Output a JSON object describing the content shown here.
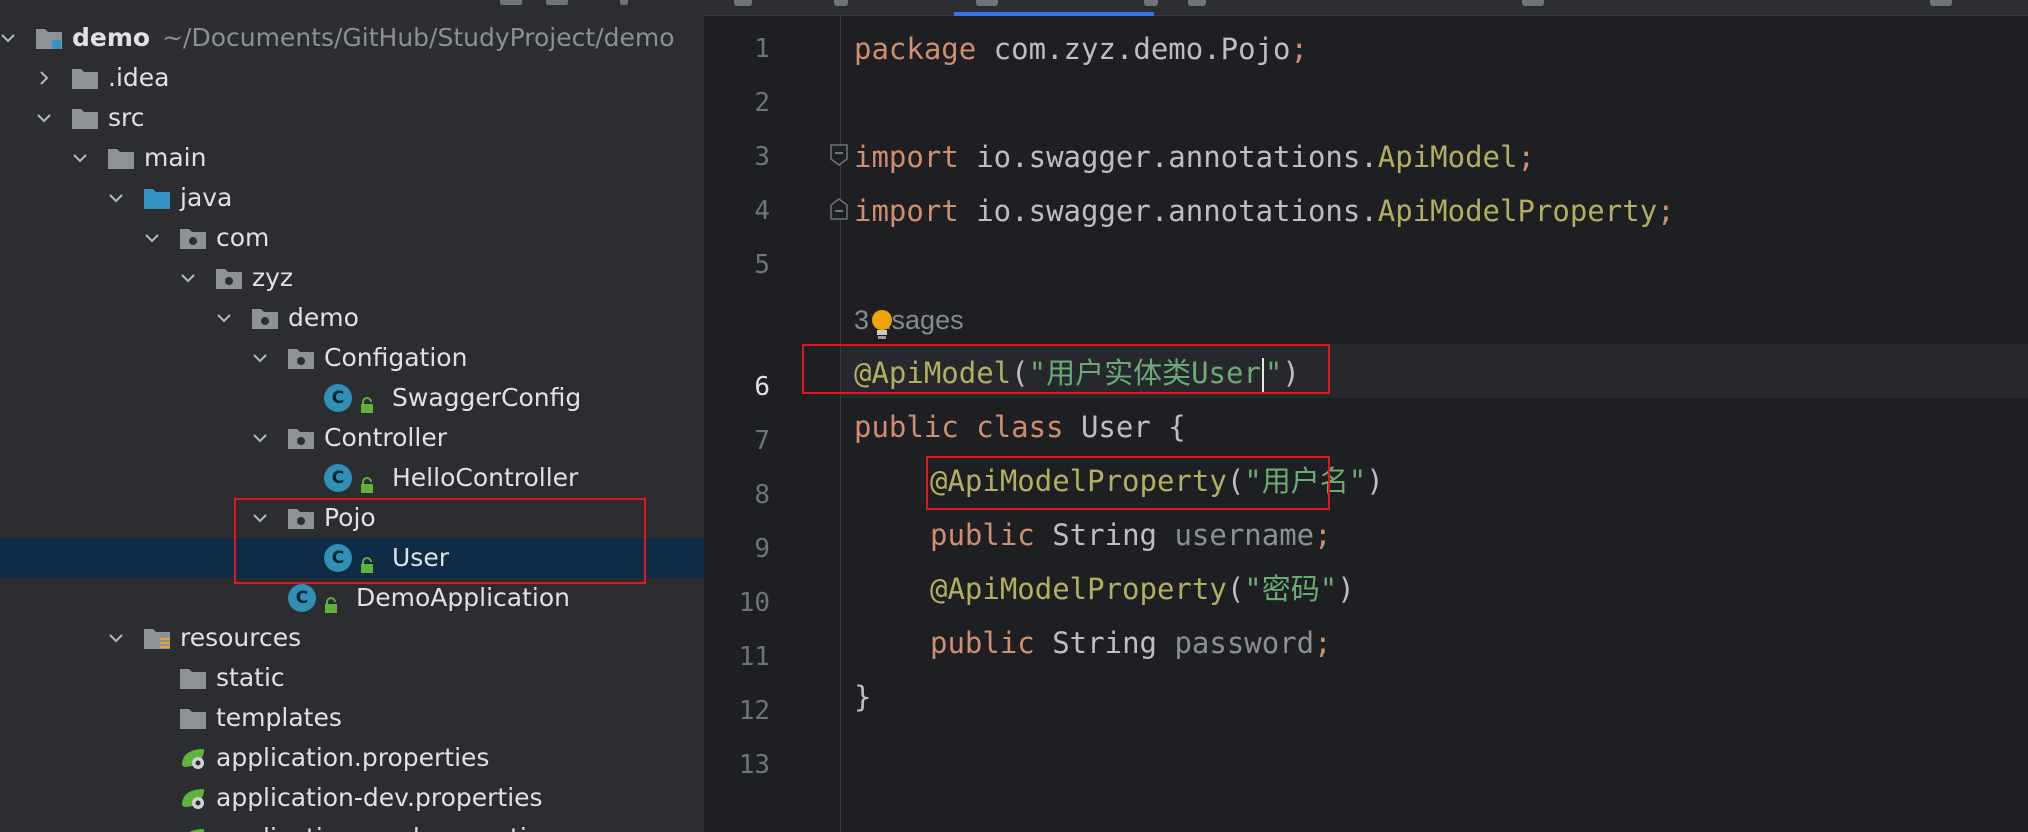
{
  "project_tree": {
    "rows": [
      {
        "name": "demo",
        "path": "~/Documents/GitHub/StudyProject/demo"
      },
      {
        "name": ".idea"
      },
      {
        "name": "src"
      },
      {
        "name": "main"
      },
      {
        "name": "java"
      },
      {
        "name": "com"
      },
      {
        "name": "zyz"
      },
      {
        "name": "demo"
      },
      {
        "name": "Configation"
      },
      {
        "name": "SwaggerConfig"
      },
      {
        "name": "Controller"
      },
      {
        "name": "HelloController"
      },
      {
        "name": "Pojo"
      },
      {
        "name": "User"
      },
      {
        "name": "DemoApplication"
      },
      {
        "name": "resources"
      },
      {
        "name": "static"
      },
      {
        "name": "templates"
      },
      {
        "name": "application.properties"
      },
      {
        "name": "application-dev.properties"
      },
      {
        "name": "application-prod.properties"
      }
    ],
    "class_badge": "C"
  },
  "editor": {
    "line_numbers": [
      "1",
      "2",
      "3",
      "4",
      "5",
      "6",
      "7",
      "8",
      "9",
      "10",
      "11",
      "12",
      "13"
    ],
    "usage_hint": "3 usages",
    "code": {
      "l1_kw": "package",
      "l1_pkg": " com.zyz.demo.Pojo",
      "semi": ";",
      "l3_kw": "import",
      "l3_pkg": " io.swagger.annotations.",
      "l3_cls": "ApiModel",
      "l4_kw": "import",
      "l4_pkg": " io.swagger.annotations.",
      "l4_cls": "ApiModelProperty",
      "l6_ann": "@ApiModel",
      "l6_open": "(",
      "l6_str_a": "\"用户实体类User",
      "l6_str_b": "\"",
      "l6_close": ")",
      "l7_kw": "public class",
      "l7_cls": " User {",
      "l8_ann": "@ApiModelProperty",
      "l8_str": "\"用户名\"",
      "l9_kw": "public",
      "l9_type": " String ",
      "l9_field": "username",
      "l10_ann": "@ApiModelProperty",
      "l10_str": "\"密码\"",
      "l11_kw": "public",
      "l11_type": " String ",
      "l11_field": "password",
      "l12_brace": "}"
    }
  },
  "colors": {
    "tree_bg": "#2b2d30",
    "editor_bg": "#1e1f22",
    "selection": "#0f2b46",
    "highlight_box": "#e0161b",
    "keyword": "#cf8e6d",
    "annotation": "#b3ae60",
    "string": "#6aab73",
    "field": "#8c8f94"
  }
}
